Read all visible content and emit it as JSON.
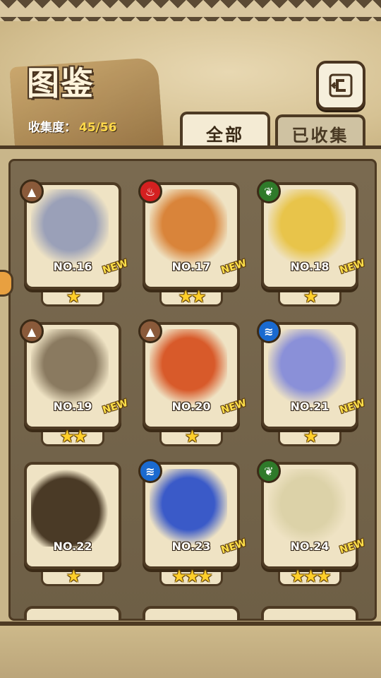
{
  "header": {
    "title": "图鉴",
    "collect_label": "收集度：",
    "collect_value": "45/56"
  },
  "tabs": [
    {
      "label": "全部",
      "active": true
    },
    {
      "label": "已收集",
      "active": false
    }
  ],
  "colors": {
    "frame_dark": "#4d3a23",
    "card_bg": "#efe3c4",
    "star": "#ffcf2a",
    "new_text": "#ffe04a"
  },
  "cards": [
    {
      "number": "NO.16",
      "element": "earth",
      "element_icon": "mountain-icon",
      "stars": "★",
      "new": "NEW",
      "portrait_color": "#9aa0b8"
    },
    {
      "number": "NO.17",
      "element": "fire",
      "element_icon": "flame-icon",
      "stars": "★★",
      "new": "NEW",
      "portrait_color": "#d9843a"
    },
    {
      "number": "NO.18",
      "element": "plant",
      "element_icon": "leaf-icon",
      "stars": "★",
      "new": "NEW",
      "portrait_color": "#e8c44a"
    },
    {
      "number": "NO.19",
      "element": "earth",
      "element_icon": "mountain-icon",
      "stars": "★★",
      "new": "NEW",
      "portrait_color": "#8a7a60"
    },
    {
      "number": "NO.20",
      "element": "earth",
      "element_icon": "mountain-icon",
      "stars": "★",
      "new": "NEW",
      "portrait_color": "#d85a2a"
    },
    {
      "number": "NO.21",
      "element": "water",
      "element_icon": "waves-icon",
      "stars": "★",
      "new": "NEW",
      "portrait_color": "#8a90d8"
    },
    {
      "number": "NO.22",
      "element": "",
      "element_icon": "",
      "stars": "★",
      "new": "",
      "portrait_color": "#4a3a26"
    },
    {
      "number": "NO.23",
      "element": "water",
      "element_icon": "waves-icon",
      "stars": "★★★",
      "new": "NEW",
      "portrait_color": "#3a5ac8"
    },
    {
      "number": "NO.24",
      "element": "plant",
      "element_icon": "leaf-icon",
      "stars": "★★★",
      "new": "NEW",
      "portrait_color": "#dcd2a8"
    }
  ]
}
